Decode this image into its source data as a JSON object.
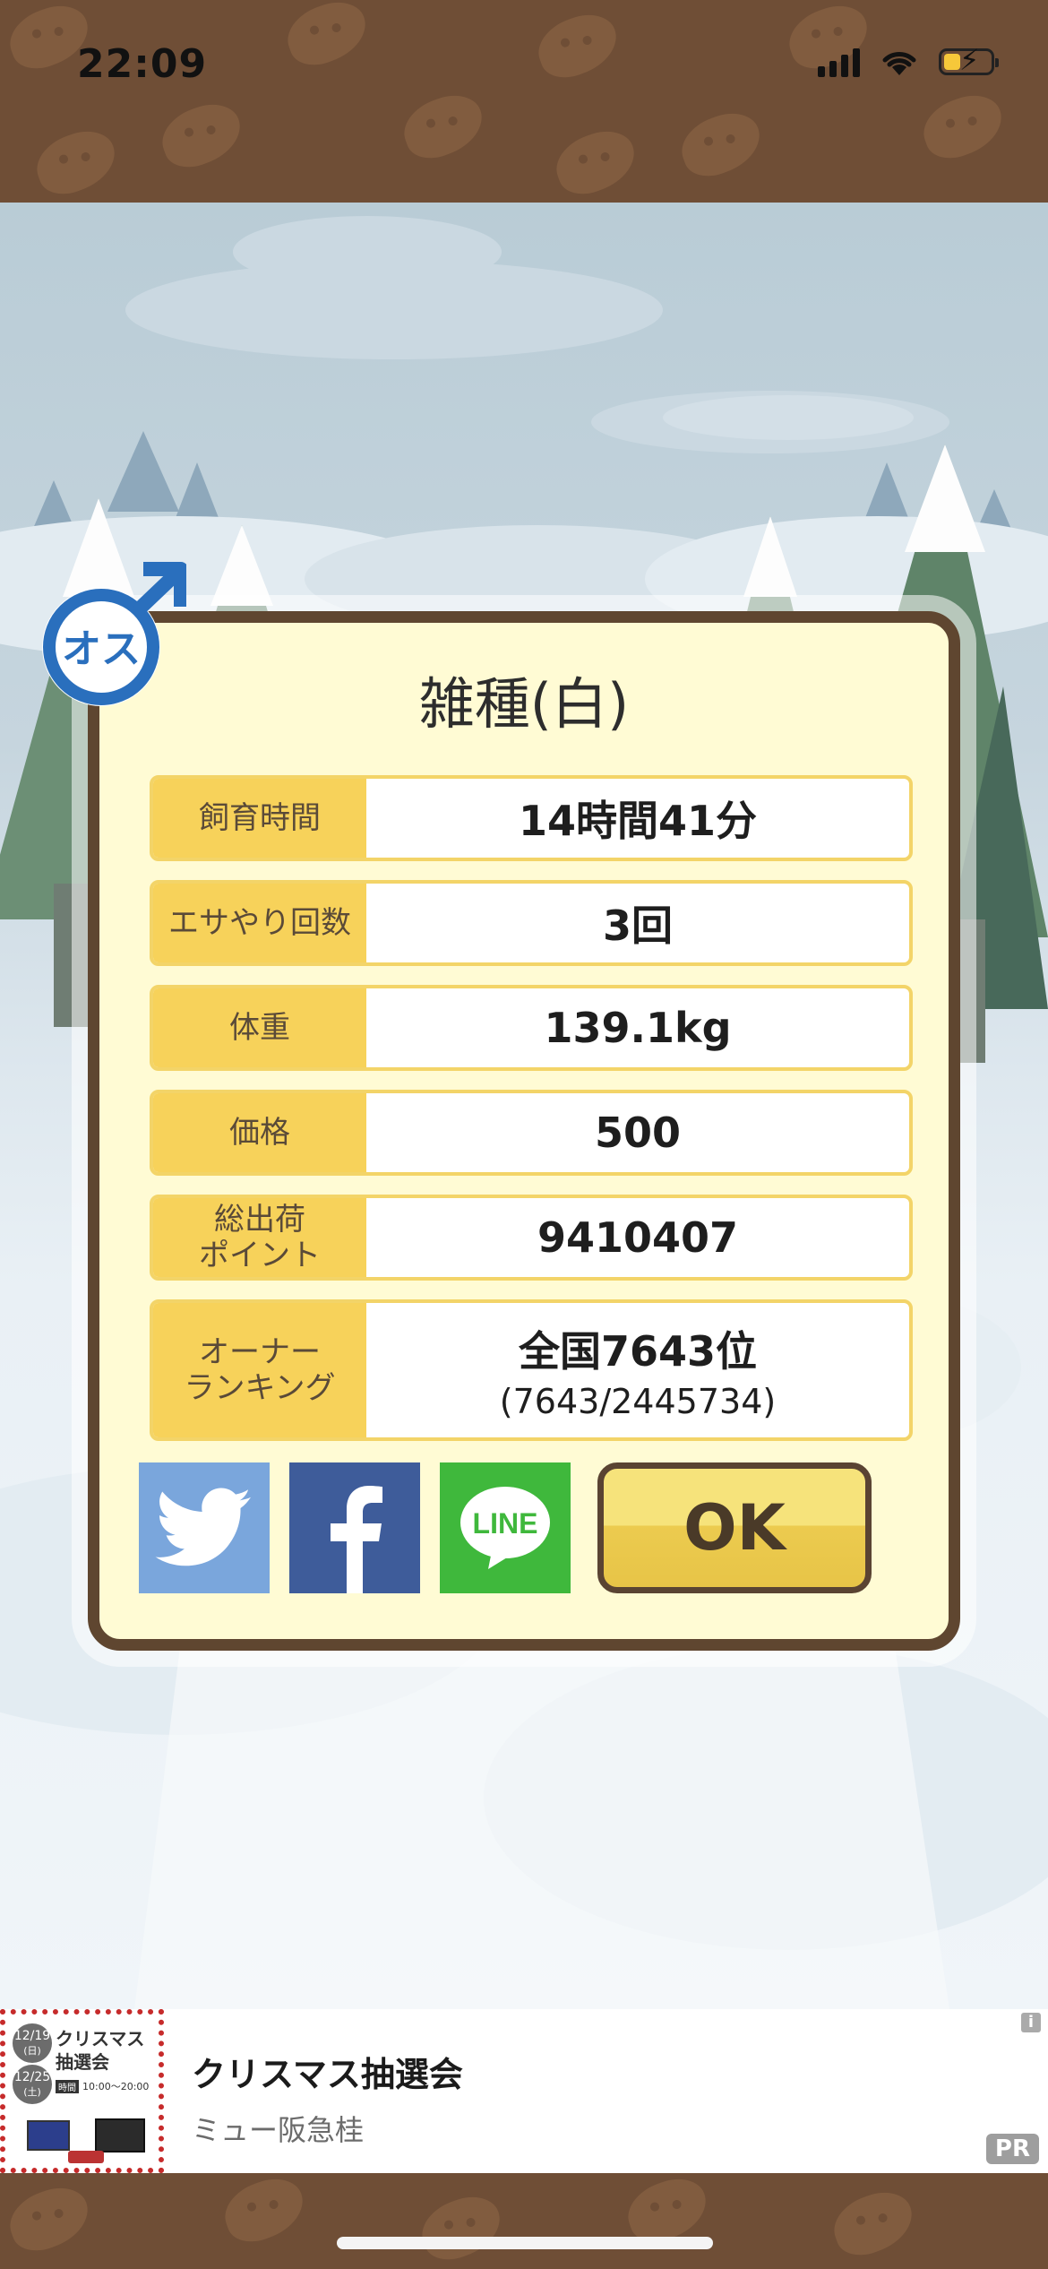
{
  "status_bar": {
    "time": "22:09",
    "battery_color": "#f6c83a"
  },
  "dialog": {
    "title": "雑種(白)",
    "gender_badge": {
      "label": "オス",
      "symbol": "male-symbol",
      "color": "#2a6fbd"
    },
    "rows": [
      {
        "label": "飼育時間",
        "value": "14時間41分"
      },
      {
        "label": "エサやり回数",
        "value": "3回"
      },
      {
        "label": "体重",
        "value": "139.1kg"
      },
      {
        "label": "価格",
        "value": "500"
      },
      {
        "label": "総出荷\nポイント",
        "value": "9410407"
      },
      {
        "label": "オーナー\nランキング",
        "value": "全国7643位",
        "sub": "(7643/2445734)"
      }
    ],
    "share_buttons": [
      {
        "icon": "twitter-bird-icon",
        "color": "#7aa6dc"
      },
      {
        "icon": "facebook-f-icon",
        "color": "#3e5c9a"
      },
      {
        "icon": "line-icon",
        "label": "LINE",
        "color": "#3fb83c"
      }
    ],
    "ok_label": "OK"
  },
  "ad": {
    "thumb": {
      "date1": "12/19",
      "day1": "(日)",
      "date2": "12/25",
      "day2": "(土)",
      "text": "クリスマス抽選会",
      "badge": "時間",
      "hours": "10:00〜20:00"
    },
    "title": "クリスマス抽選会",
    "subtitle": "ミュー阪急桂",
    "info_icon": "i",
    "badge": "PR"
  }
}
